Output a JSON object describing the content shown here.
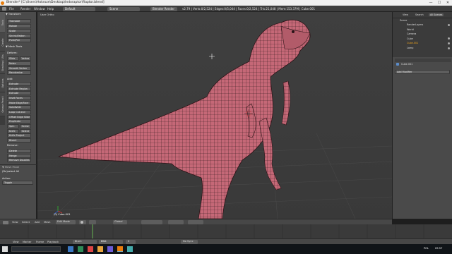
{
  "titlebar": {
    "title": "Blender* [C:\\Users\\Hokroze\\Desktop\\Indoraptor\\Raptor.blend]",
    "minimize": "—",
    "maximize": "☐",
    "close": "✕"
  },
  "infobar": {
    "menus": [
      "File",
      "Render",
      "Window",
      "Help"
    ],
    "layout": "Default",
    "scene": "Scene",
    "engine": "Blender Render",
    "stats": "v2.79 | Verts:0/2,524 | Edges:0/5,044 | Faces:0/2,524 | Tris:21,048 | Mem:153.37M | Cube.001"
  },
  "toolshelf": {
    "tabs": [
      "Tools",
      "Create",
      "Shading / UVs",
      "Options",
      "Grease Pencil"
    ],
    "transform_header": "▼ Transform",
    "transform": [
      "Translate",
      "Rotate",
      "Scale",
      "Shrink/Fatten",
      "Push/Pull"
    ],
    "meshtools_header": "▼ Mesh Tools",
    "deform_label": "Deform:",
    "slide_edge": "Slide Edge",
    "vertex": "Vertex",
    "deform": [
      "Noise",
      "Smooth Vertex",
      "Randomize"
    ],
    "add_label": "Add:",
    "add": [
      "Extrude",
      "Extrude Region",
      "Extrude Individual",
      "Inset Faces",
      "Make Edge/Face",
      "Subdivide",
      "Loop Cut and Slide",
      "Offset Edge Slide",
      "Duplicate"
    ],
    "spin": "Spin",
    "screw": "Screw",
    "knife": "Knife",
    "select": "Select",
    "knife_project": "Knife Project",
    "bisect": "Bisect",
    "remove_label": "Remove:",
    "remove": [
      "Delete",
      "Merge",
      "Remove Doubles"
    ],
    "operator_header": "▼ Mesh Panel",
    "deselect_all": "(De)select All",
    "action_label": "Action:",
    "action_value": "Toggle"
  },
  "viewport": {
    "view_label": "User Ortho",
    "object_label": "(0) Cube.001"
  },
  "vpheader": {
    "view": "View",
    "select": "Select",
    "add": "Add",
    "mesh": "Mesh",
    "mode": "Edit Mode",
    "pivot": "Global"
  },
  "outliner": {
    "view": "View",
    "search": "Search",
    "scenes": "All Scenes",
    "items": [
      "Scene",
      "RenderLayers",
      "World",
      "Camera",
      "Cube",
      "Cube.001",
      "Lamp"
    ]
  },
  "props": {
    "object": "Cube.001",
    "add_modifier": "Add Modifier"
  },
  "tlhdr": {
    "view": "View",
    "marker": "Marker",
    "frame": "Frame",
    "playback": "Playback",
    "start": "Start:",
    "start_val": "1",
    "end": "End:",
    "end_val": "250",
    "current": "0",
    "sync": "No Sync"
  },
  "taskbar": {
    "lang": "POL",
    "time": "09:57"
  },
  "colors": {
    "accent": "#e87d0d",
    "selected": "#f1a41a",
    "mesh": "#c66a78"
  }
}
